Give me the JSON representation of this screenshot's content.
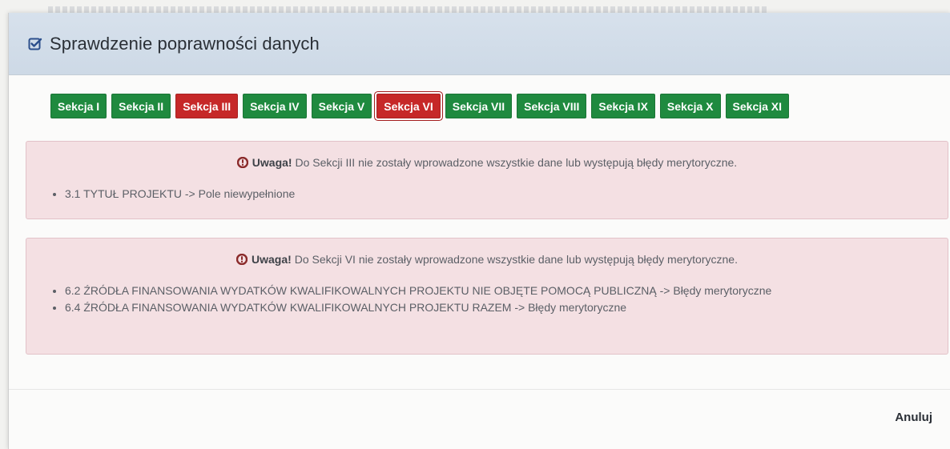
{
  "dialog": {
    "title": "Sprawdzenie poprawności danych"
  },
  "tabs": [
    {
      "label": "Sekcja I",
      "status": "ok"
    },
    {
      "label": "Sekcja II",
      "status": "ok"
    },
    {
      "label": "Sekcja III",
      "status": "error"
    },
    {
      "label": "Sekcja IV",
      "status": "ok"
    },
    {
      "label": "Sekcja V",
      "status": "ok"
    },
    {
      "label": "Sekcja VI",
      "status": "error",
      "selected": true
    },
    {
      "label": "Sekcja VII",
      "status": "ok"
    },
    {
      "label": "Sekcja VIII",
      "status": "ok"
    },
    {
      "label": "Sekcja IX",
      "status": "ok"
    },
    {
      "label": "Sekcja X",
      "status": "ok"
    },
    {
      "label": "Sekcja XI",
      "status": "ok"
    }
  ],
  "alerts": [
    {
      "strong": "Uwaga!",
      "message": "Do Sekcji III nie zostały wprowadzone wszystkie dane lub występują błędy merytoryczne.",
      "items": [
        "3.1 TYTUŁ PROJEKTU -> Pole niewypełnione"
      ]
    },
    {
      "strong": "Uwaga!",
      "message": "Do Sekcji VI nie zostały wprowadzone wszystkie dane lub występują błędy merytoryczne.",
      "items": [
        "6.2 ŹRÓDŁA FINANSOWANIA WYDATKÓW KWALIFIKOWALNYCH PROJEKTU NIE OBJĘTE POMOCĄ PUBLICZNĄ -> Błędy merytoryczne",
        "6.4 ŹRÓDŁA FINANSOWANIA WYDATKÓW KWALIFIKOWALNYCH PROJEKTU RAZEM -> Błędy merytoryczne"
      ]
    }
  ],
  "footer": {
    "cancel_label": "Anuluj"
  },
  "colors": {
    "ok": "#1f8a3f",
    "error": "#c62828",
    "alert_bg": "#f4e0e3"
  },
  "icons": {
    "title": "check-square-icon",
    "alert": "exclamation-circle-icon"
  }
}
